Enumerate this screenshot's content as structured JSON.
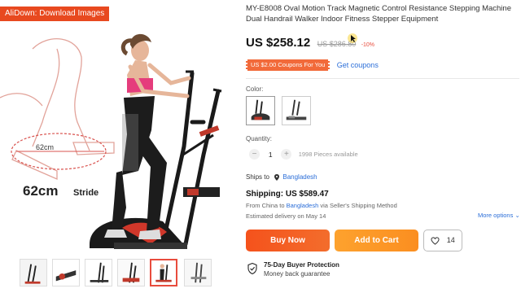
{
  "gallery": {
    "badge": "AliDown: Download Images",
    "diagram_measure_small": "62cm",
    "diagram_measure_large": "62cm",
    "diagram_caption": "Stride",
    "thumbnail_count": 6,
    "active_thumbnail": 5
  },
  "product": {
    "title": "MY-E8008 Oval Motion Track Magnetic Control Resistance Stepping Machine Dual Handrail Walker Indoor Fitness Stepper Equipment",
    "price": "US $258.12",
    "old_price": "US $286.80",
    "discount": "-10%"
  },
  "coupon": {
    "badge": "US $2.00 Coupons For You",
    "link": "Get coupons"
  },
  "options": {
    "color_label": "Color:",
    "quantity_label": "Quantity:",
    "quantity_minus": "−",
    "quantity_value": "1",
    "quantity_plus": "+",
    "available": "1998 Pieces available"
  },
  "shipping": {
    "ships_to_label": "Ships to",
    "ships_to_country": "Bangladesh",
    "cost": "Shipping: US $589.47",
    "from_prefix": "From China to",
    "from_country": "Bangladesh",
    "from_suffix": "via Seller's Shipping Method",
    "delivery": "Estimated delivery on May 14",
    "more_options": "More options ⌄"
  },
  "actions": {
    "buy_now": "Buy Now",
    "add_to_cart": "Add to Cart",
    "wishlist_count": "14"
  },
  "protection": {
    "title": "75-Day Buyer Protection",
    "subtitle": "Money back guarantee"
  },
  "colors": {
    "accent": "#f5521c",
    "cart": "#fb8e20",
    "link": "#2b6ed8"
  }
}
